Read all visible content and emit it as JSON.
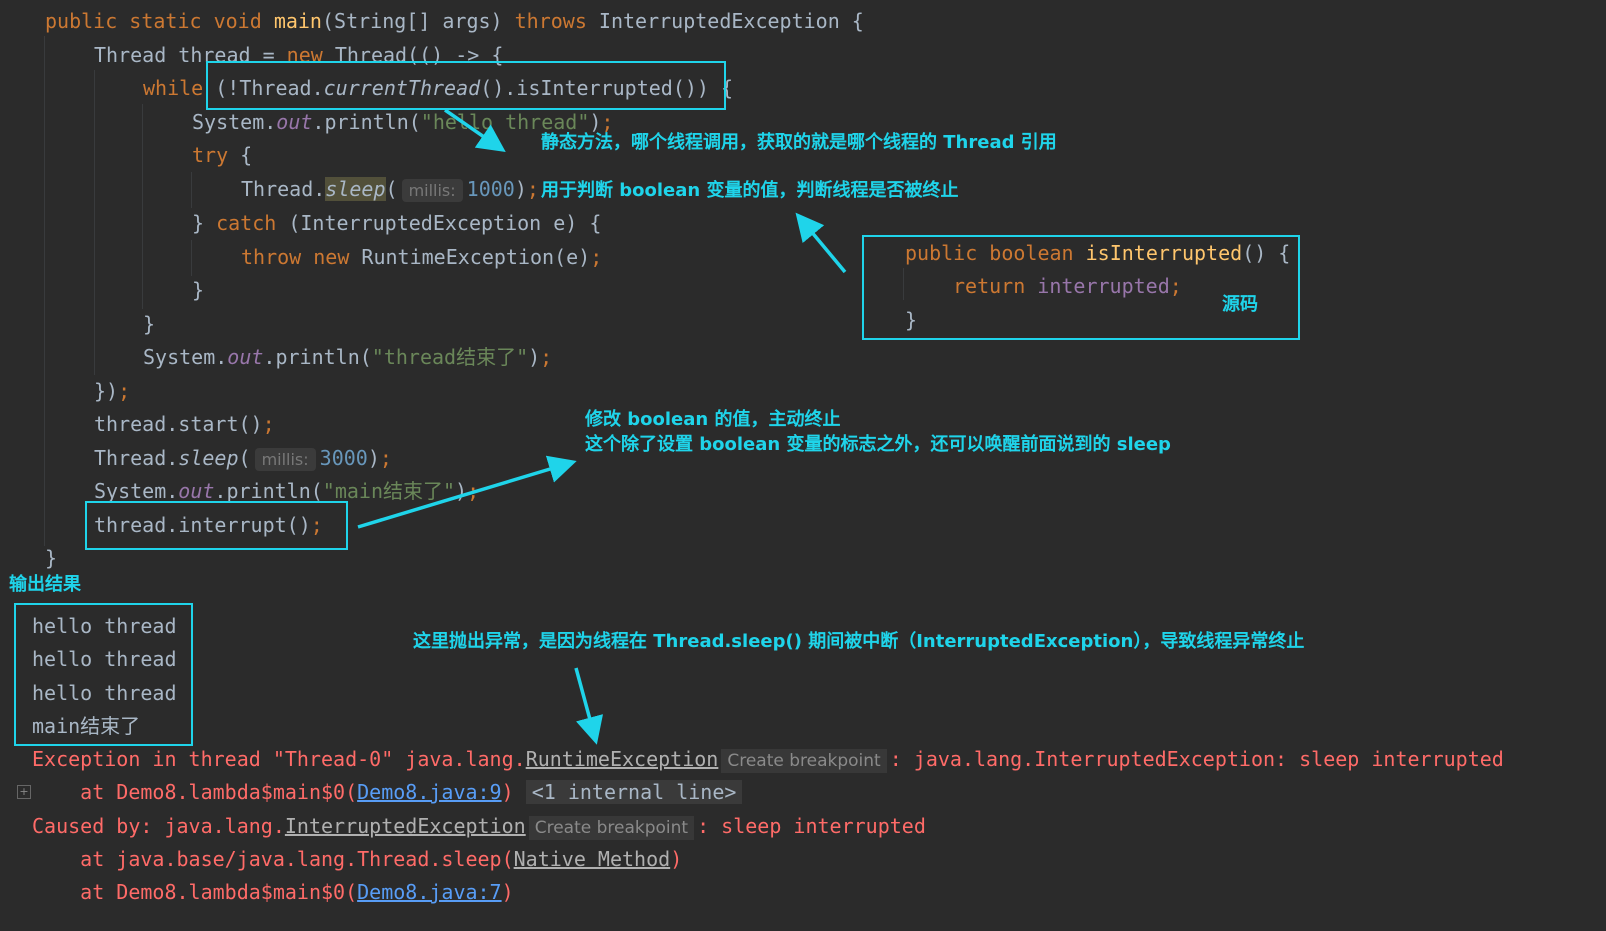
{
  "code": {
    "l1": {
      "public": "public",
      "static": "static",
      "void": "void",
      "main": "main",
      "params": "(String[] args) ",
      "throws": "throws",
      "exc": " InterruptedException {"
    },
    "l2": {
      "pre": "Thread thread = ",
      "new": "new",
      "post": " Thread(() -> {"
    },
    "l3": {
      "while": "while",
      "cond_a": " (!Thread.",
      "current": "currentThread",
      "cond_b": "().isInterrupted())",
      "brace": " {"
    },
    "l4": {
      "pre": "System.",
      "out": "out",
      "mid": ".println(",
      "str": "\"hello thread\"",
      "end": ")",
      "semi": ";"
    },
    "l5": {
      "try": "try",
      "brace": " {"
    },
    "l6": {
      "pre": "Thread.",
      "sleep": "sleep",
      "open": "(",
      "hint": "millis:",
      "num": "1000",
      "close": ")",
      "semi": ";"
    },
    "l7": {
      "pre": "} ",
      "catch": "catch",
      "post": " (InterruptedException e) {"
    },
    "l8": {
      "throw": "throw",
      "sp": " ",
      "new": "new",
      "post": " RuntimeException(e)",
      "semi": ";"
    },
    "l9": "}",
    "l10": "}",
    "l11": {
      "pre": "System.",
      "out": "out",
      "mid": ".println(",
      "str": "\"thread结束了\"",
      "end": ")",
      "semi": ";"
    },
    "l12": {
      "text": "})",
      "semi": ";"
    },
    "l13": {
      "text": "thread.start()",
      "semi": ";"
    },
    "l14": {
      "pre": "Thread.",
      "sleep": "sleep",
      "open": "(",
      "hint": "millis:",
      "num": "3000",
      "close": ")",
      "semi": ";"
    },
    "l15": {
      "pre": "System.",
      "out": "out",
      "mid": ".println(",
      "str": "\"main结束了\"",
      "end": ")",
      "semi": ";"
    },
    "l16": {
      "text": "thread.interrupt()",
      "semi": ";"
    },
    "l17": "}"
  },
  "source_box": {
    "l1": {
      "public": "public",
      "boolean": "boolean",
      "name": "isInterrupted",
      "rest": "() {"
    },
    "l2": {
      "return": "return",
      "field": "interrupted",
      "semi": ";"
    },
    "l3": "}",
    "label": "源码"
  },
  "annotations": {
    "static_method": "静态方法，哪个线程调用，获取的就是哪个线程的 Thread 引用",
    "boolean_judge": "用于判断 boolean 变量的值，判断线程是否被终止",
    "modify_line1": "修改 boolean 的值，主动终止",
    "modify_line2": "这个除了设置 boolean 变量的标志之外，还可以唤醒前面说到的 sleep",
    "output_label": "输出结果",
    "exception_note": "这里抛出异常，是因为线程在 Thread.sleep() 期间被中断（InterruptedException），导致线程异常终止"
  },
  "output": [
    "hello thread",
    "hello thread",
    "hello thread",
    "main结束了"
  ],
  "trace": {
    "e1_pre": "Exception in thread \"Thread-0\" java.lang.",
    "e1_link": "RuntimeException",
    "e1_cbp": "Create breakpoint",
    "e1_post": ": java.lang.InterruptedException: sleep interrupted",
    "e2_pre": "    at Demo8.lambda$main$0(",
    "e2_link": "Demo8.java:9",
    "e2_close": ")",
    "e2_internal": "<1 internal line>",
    "e3_pre": "Caused by: java.lang.",
    "e3_link": "InterruptedException",
    "e3_cbp": "Create breakpoint",
    "e3_post": ": sleep interrupted",
    "e4_pre": "    at java.base/java.lang.Thread.sleep(",
    "e4_link": "Native Method",
    "e4_close": ")",
    "e5_pre": "    at Demo8.lambda$main$0(",
    "e5_link": "Demo8.java:7",
    "e5_close": ")"
  },
  "colors": {
    "annotation": "#1fd4ea",
    "keyword": "#cc7832",
    "error": "#ff6b68",
    "background": "#2b2b2b"
  }
}
